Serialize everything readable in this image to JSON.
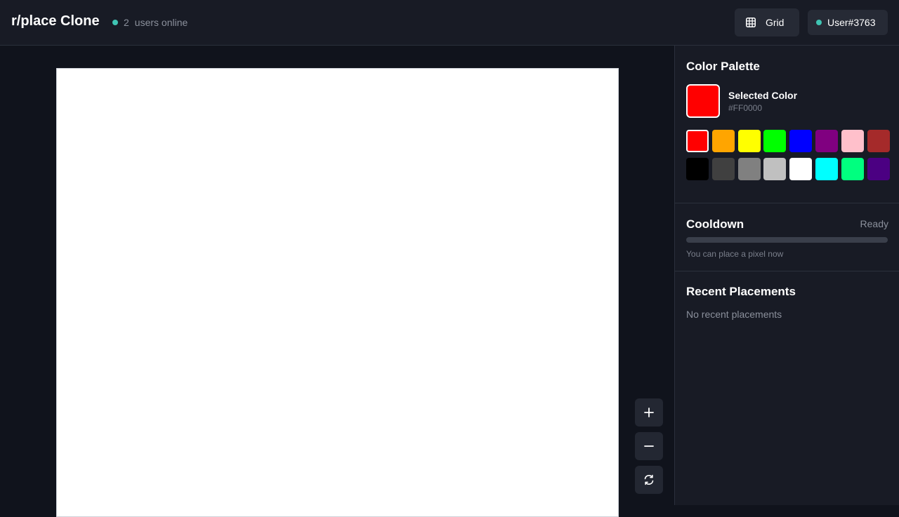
{
  "header": {
    "title": "r/place Clone",
    "online_count": "2",
    "online_label": "users online",
    "grid_button_label": "Grid",
    "user_label": "User#3763",
    "status_color": "#3fc4b3"
  },
  "canvas": {
    "background": "#FFFFFF"
  },
  "zoom_controls": {
    "zoom_in_icon": "plus-icon",
    "zoom_out_icon": "minus-icon",
    "reset_icon": "refresh-icon"
  },
  "palette": {
    "title": "Color Palette",
    "selected_label": "Selected Color",
    "selected_hex": "#FF0000",
    "selected_color": "#FF0000",
    "colors": [
      "#FF0000",
      "#FFA500",
      "#FFFF00",
      "#00FF00",
      "#0000FF",
      "#800080",
      "#FFC0CB",
      "#A52A2A",
      "#000000",
      "#404040",
      "#808080",
      "#C0C0C0",
      "#FFFFFF",
      "#00FFFF",
      "#00FF7F",
      "#4B0082"
    ]
  },
  "cooldown": {
    "title": "Cooldown",
    "status": "Ready",
    "progress": 0,
    "message": "You can place a pixel now"
  },
  "recent": {
    "title": "Recent Placements",
    "empty_message": "No recent placements"
  }
}
